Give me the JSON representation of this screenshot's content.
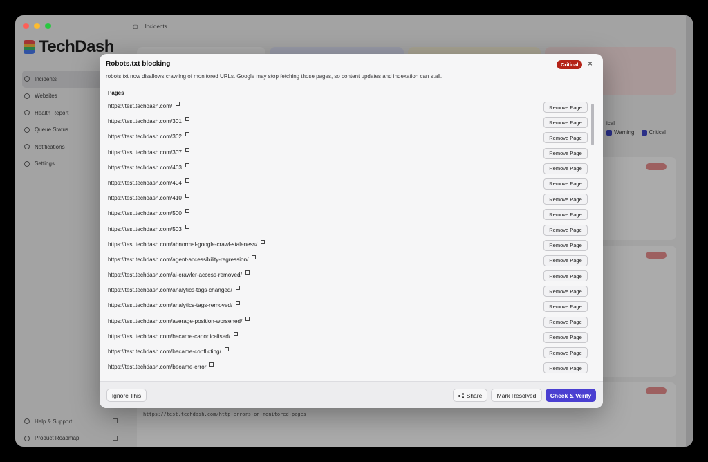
{
  "app": {
    "name": "TechDash",
    "breadcrumb": "Incidents",
    "nav": [
      "Incidents",
      "Websites",
      "Health Report",
      "Queue Status",
      "Notifications",
      "Settings"
    ],
    "nav_bottom": [
      "Help & Support",
      "Product Roadmap"
    ],
    "legend": {
      "title": "ical",
      "items": [
        "Warning",
        "Critical"
      ]
    },
    "background_url": "https://test.techdash.com/http-errors-on-monitored-pages"
  },
  "modal": {
    "title": "Robots.txt blocking",
    "badge": "Critical",
    "close": "×",
    "description": "robots.txt now disallows crawling of monitored URLs. Google may stop fetching those pages, so content updates and indexation can stall.",
    "pages_label": "Pages",
    "remove_label": "Remove Page",
    "pages": [
      "https://test.techdash.com/",
      "https://test.techdash.com/301",
      "https://test.techdash.com/302",
      "https://test.techdash.com/307",
      "https://test.techdash.com/403",
      "https://test.techdash.com/404",
      "https://test.techdash.com/410",
      "https://test.techdash.com/500",
      "https://test.techdash.com/503",
      "https://test.techdash.com/abnormal-google-crawl-staleness/",
      "https://test.techdash.com/agent-accessibility-regression/",
      "https://test.techdash.com/ai-crawler-access-removed/",
      "https://test.techdash.com/analytics-tags-changed/",
      "https://test.techdash.com/analytics-tags-removed/",
      "https://test.techdash.com/average-position-worsened/",
      "https://test.techdash.com/became-canonicalised/",
      "https://test.techdash.com/became-conflicting/",
      "https://test.techdash.com/became-error"
    ],
    "footer": {
      "ignore": "Ignore This",
      "share": "Share",
      "resolve": "Mark Resolved",
      "verify": "Check & Verify"
    }
  },
  "colors": {
    "critical": "#b42318",
    "primary": "#4a3fd1"
  }
}
